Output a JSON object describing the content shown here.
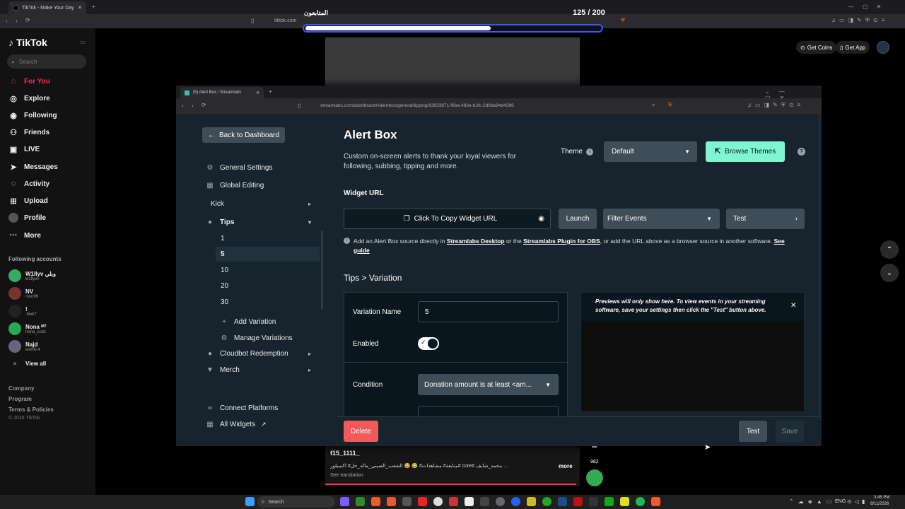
{
  "outer": {
    "tab_title": "TikTok - Make Your Day",
    "url": "tiktok.com",
    "progress_label": "المتابعون",
    "progress_count": "125 / 200",
    "progress_fraction": 0.62,
    "get_coins": "Get Coins",
    "get_app": "Get App"
  },
  "tiktok": {
    "logo": "TikTok",
    "search_placeholder": "Search",
    "nav": [
      "For You",
      "Explore",
      "Following",
      "Friends",
      "LIVE",
      "Messages",
      "Activity",
      "Upload",
      "Profile",
      "More"
    ],
    "following_title": "Following accounts",
    "accounts": [
      {
        "name": "W1llyv وبلي",
        "handle": "w1llyvv"
      },
      {
        "name": "NV",
        "handle": "mvn99"
      },
      {
        "name": "!",
        "handle": ".6wk7"
      },
      {
        "name": "Nona ᴹᵀ",
        "handle": "nona_sxb1"
      },
      {
        "name": "Najd",
        "handle": "esmki.4"
      }
    ],
    "view_all": "View all",
    "footer": [
      "Company",
      "Program",
      "Terms & Policies",
      "© 2026 TikTok"
    ],
    "video_user": "f15_1111_",
    "video_caption": "متابعة# مشاهدات# 😂 😂 الشعب_الصيني_ماله_حل# اكسبلور# core# محمد_شايف ...",
    "more": "more",
    "see_translation": "See translation",
    "share_count": "982"
  },
  "streamlabs": {
    "tab_title": "(5) Alert Box / Streamlabs",
    "url": "streamlabs.com/dashboard#/alertbox/general/tipping/63633871-f6ba-483e-b2fc-2d6da94d4289",
    "back": "Back to Dashboard",
    "sidebar": {
      "general": "General Settings",
      "global": "Global Editing",
      "kick": "Kick",
      "tips": "Tips",
      "tip_values": [
        "1",
        "5",
        "10",
        "20",
        "30"
      ],
      "add_variation": "Add Variation",
      "manage_variations": "Manage Variations",
      "cloudbot": "Cloudbot Redemption",
      "merch": "Merch",
      "connect": "Connect Platforms",
      "all_widgets": "All Widgets"
    },
    "title": "Alert Box",
    "description": "Custom on-screen alerts to thank your loyal viewers for following, subbing, tipping and more.",
    "theme_label": "Theme",
    "theme_value": "Default",
    "browse_themes": "Browse Themes",
    "widget_url_label": "Widget URL",
    "copy_url": "Click To Copy Widget URL",
    "launch": "Launch",
    "filter_events": "Filter Events",
    "test_dd": "Test",
    "info_pre": "Add an Alert Box source directly in",
    "info_link1": "Streamlabs Desktop",
    "info_mid1": "or the",
    "info_link2": "Streamlabs Plugin for OBS",
    "info_mid2": ", or add the URL above as a browser source in another software.",
    "info_link3": "See guide",
    "variation_heading": "Tips > Variation",
    "variation_name_label": "Variation Name",
    "variation_name_value": "5",
    "enabled_label": "Enabled",
    "enabled": true,
    "condition_label": "Condition",
    "condition_value": "Donation amount is at least <am...",
    "preview_note": "Previews will only show here. To view events in your streaming software, save your settings then click the \"Test\" button above.",
    "delete": "Delete",
    "test": "Test",
    "save": "Save"
  },
  "taskbar": {
    "search": "Search",
    "lang": "ENG",
    "time": "3:45 PM",
    "date": "8/11/2026"
  }
}
